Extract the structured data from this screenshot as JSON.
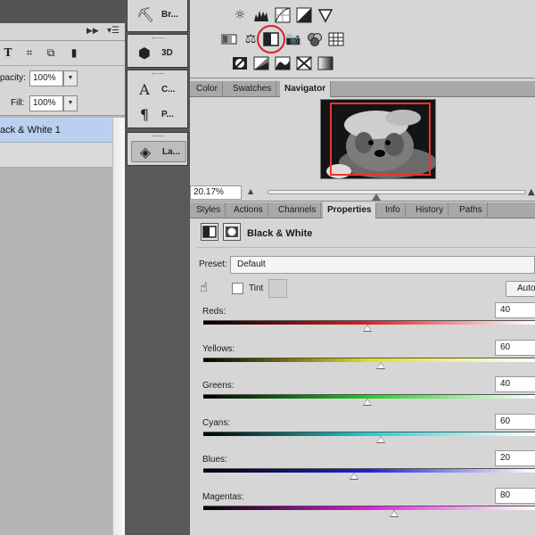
{
  "layers_panel": {
    "opacity_label": "pacity:",
    "opacity_value": "100%",
    "fill_label": "Fill:",
    "fill_value": "100%",
    "layer_name": "ack & White 1",
    "filter_icons": [
      "type-filter-icon",
      "shape-filter-icon",
      "smart-object-filter-icon",
      "toggle-filter-icon"
    ]
  },
  "dock": {
    "items": [
      {
        "icon": "brush-icon",
        "label": "Br..."
      },
      {
        "icon": "3d-icon",
        "label": "3D"
      },
      {
        "icon": "character-icon",
        "label": "C..."
      },
      {
        "icon": "paragraph-icon",
        "label": "P..."
      },
      {
        "icon": "layers-icon",
        "label": "La..."
      }
    ]
  },
  "adjustments": {
    "highlighted": "black-white-adjustment-icon",
    "highlight_color": "#e02020"
  },
  "navigator": {
    "tabs": [
      "Color",
      "Swatches",
      "Navigator"
    ],
    "active_tab": "Navigator",
    "zoom": "20.17%",
    "zoom_slider_fraction": 0.42,
    "view_box_color": "#e33333"
  },
  "properties": {
    "tabs": [
      "Styles",
      "Actions",
      "Channels",
      "Properties",
      "Info",
      "History",
      "Paths"
    ],
    "active_tab": "Properties",
    "title": "Black & White",
    "preset_label": "Preset:",
    "preset_value": "Default",
    "tint_label": "Tint",
    "auto_label": "Auto",
    "sliders": [
      {
        "label": "Reds:",
        "value": "40",
        "fraction": 0.494,
        "color": "#e02020"
      },
      {
        "label": "Yellows:",
        "value": "60",
        "fraction": 0.534,
        "color": "#e0e020"
      },
      {
        "label": "Greens:",
        "value": "40",
        "fraction": 0.494,
        "color": "#20d020"
      },
      {
        "label": "Cyans:",
        "value": "60",
        "fraction": 0.534,
        "color": "#20d0d0"
      },
      {
        "label": "Blues:",
        "value": "20",
        "fraction": 0.454,
        "color": "#2020e0"
      },
      {
        "label": "Magentas:",
        "value": "80",
        "fraction": 0.574,
        "color": "#e020e0"
      }
    ]
  }
}
